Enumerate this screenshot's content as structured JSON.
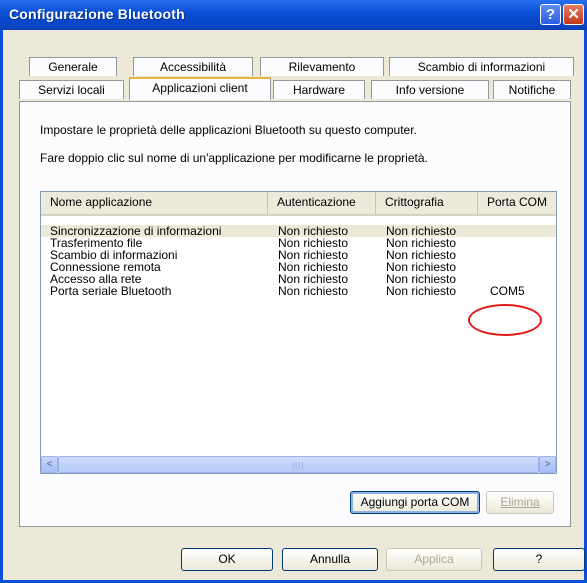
{
  "window": {
    "title": "Configurazione Bluetooth",
    "help_glyph": "?",
    "close_glyph": "✕"
  },
  "tabs": {
    "row_back": [
      "Generale",
      "Accessibilità",
      "Rilevamento",
      "Scambio di informazioni"
    ],
    "row_front": [
      "Servizi locali",
      "Applicazioni client",
      "Hardware",
      "Info versione",
      "Notifiche"
    ],
    "active": "Applicazioni client"
  },
  "panel": {
    "description1": "Impostare le proprietà delle applicazioni Bluetooth su questo computer.",
    "description2": "Fare doppio clic sul nome di un'applicazione per modificarne le proprietà."
  },
  "table": {
    "columns": [
      "Nome applicazione",
      "Autenticazione",
      "Crittografia",
      "Porta COM"
    ],
    "rows": [
      [
        "Sincronizzazione di informazioni",
        "Non richiesto",
        "Non richiesto",
        ""
      ],
      [
        "Trasferimento file",
        "Non richiesto",
        "Non richiesto",
        ""
      ],
      [
        "Scambio di informazioni",
        "Non richiesto",
        "Non richiesto",
        ""
      ],
      [
        "Connessione remota",
        "Non richiesto",
        "Non richiesto",
        ""
      ],
      [
        "Accesso alla rete",
        "Non richiesto",
        "Non richiesto",
        ""
      ],
      [
        "Porta seriale Bluetooth",
        "Non richiesto",
        "Non richiesto",
        "COM5"
      ]
    ],
    "selected_row": 0,
    "highlighted_value": "COM5"
  },
  "scrollbar": {
    "left_glyph": "<",
    "right_glyph": ">",
    "grip": "||||"
  },
  "actions": {
    "add_com": "Aggiungi porta COM",
    "remove": "Elimina"
  },
  "footer": {
    "ok": "OK",
    "cancel": "Annulla",
    "apply": "Applica",
    "help": "?"
  },
  "colors": {
    "titlebar": "#0b4fd6",
    "active_tab_accent": "#e6b33d",
    "annotation": "#e11b1b"
  }
}
